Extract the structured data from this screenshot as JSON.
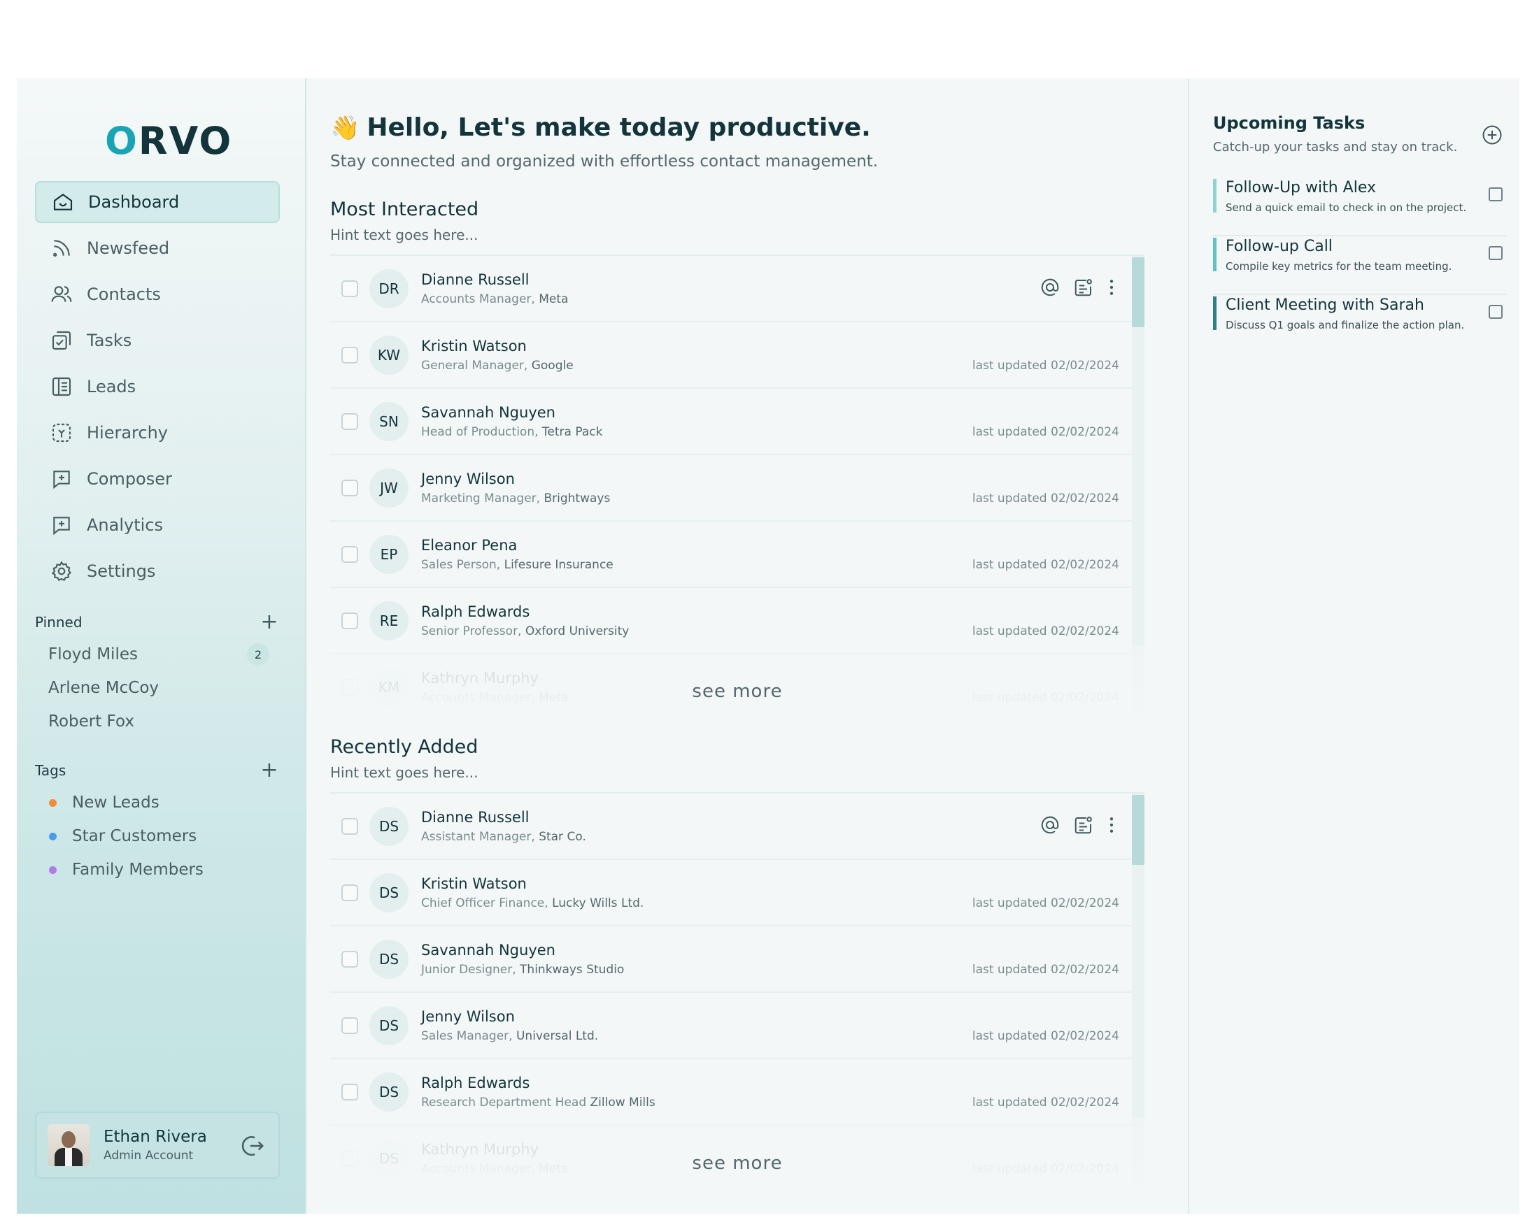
{
  "brand": {
    "logo_first": "O",
    "logo_rest": "RVO",
    "accent": "#18a4b4"
  },
  "sidebar": {
    "nav": [
      {
        "label": "Dashboard",
        "icon": "home-icon",
        "active": true
      },
      {
        "label": "Newsfeed",
        "icon": "rss-icon"
      },
      {
        "label": "Contacts",
        "icon": "users-icon"
      },
      {
        "label": "Tasks",
        "icon": "tasks-icon"
      },
      {
        "label": "Leads",
        "icon": "leads-icon"
      },
      {
        "label": "Hierarchy",
        "icon": "hierarchy-icon"
      },
      {
        "label": "Composer",
        "icon": "composer-icon"
      },
      {
        "label": "Analytics",
        "icon": "analytics-icon"
      },
      {
        "label": "Settings",
        "icon": "gear-icon"
      }
    ],
    "pinned_title": "Pinned",
    "pinned": [
      {
        "name": "Floyd Miles",
        "badge": "2"
      },
      {
        "name": "Arlene McCoy"
      },
      {
        "name": "Robert Fox"
      }
    ],
    "tags_title": "Tags",
    "tags": [
      {
        "label": "New Leads",
        "color": "#f28b3c"
      },
      {
        "label": "Star Customers",
        "color": "#4a9be8"
      },
      {
        "label": "Family Members",
        "color": "#b07be8"
      }
    ],
    "user": {
      "name": "Ethan Rivera",
      "role": "Admin Account"
    }
  },
  "main": {
    "greeting_emoji": "👋",
    "greeting": "Hello, Let's make today productive.",
    "subtitle": "Stay connected and organized with effortless contact management.",
    "most_interacted": {
      "title": "Most Interacted",
      "hint": "Hint text goes here...",
      "see_more": "see more",
      "rows": [
        {
          "initials": "DR",
          "name": "Dianne Russell",
          "role": "Accounts Manager,",
          "company": "Meta",
          "updated": ""
        },
        {
          "initials": "KW",
          "name": "Kristin Watson",
          "role": "General Manager,",
          "company": "Google",
          "updated": "last updated 02/02/2024"
        },
        {
          "initials": "SN",
          "name": "Savannah Nguyen",
          "role": "Head of Production,",
          "company": "Tetra Pack",
          "updated": "last updated 02/02/2024"
        },
        {
          "initials": "JW",
          "name": "Jenny Wilson",
          "role": "Marketing Manager,",
          "company": "Brightways",
          "updated": "last updated 02/02/2024"
        },
        {
          "initials": "EP",
          "name": "Eleanor Pena",
          "role": "Sales Person,",
          "company": "Lifesure Insurance",
          "updated": "last updated 02/02/2024"
        },
        {
          "initials": "RE",
          "name": "Ralph Edwards",
          "role": "Senior Professor,",
          "company": "Oxford University",
          "updated": "last updated 02/02/2024"
        },
        {
          "initials": "KM",
          "name": "Kathryn Murphy",
          "role": "Accounts Manager,",
          "company": "Meta",
          "updated": "last updated 02/02/2024"
        }
      ]
    },
    "recently_added": {
      "title": "Recently Added",
      "hint": "Hint text goes here...",
      "see_more": "see more",
      "rows": [
        {
          "initials": "DS",
          "name": "Dianne Russell",
          "role": "Assistant Manager,",
          "company": "Star Co.",
          "updated": ""
        },
        {
          "initials": "DS",
          "name": "Kristin Watson",
          "role": "Chief Officer Finance,",
          "company": "Lucky Wills Ltd.",
          "updated": "last updated 02/02/2024"
        },
        {
          "initials": "DS",
          "name": "Savannah Nguyen",
          "role": "Junior Designer,",
          "company": "Thinkways Studio",
          "updated": "last updated 02/02/2024"
        },
        {
          "initials": "DS",
          "name": "Jenny Wilson",
          "role": "Sales Manager,",
          "company": "Universal Ltd.",
          "updated": "last updated 02/02/2024"
        },
        {
          "initials": "DS",
          "name": "Ralph Edwards",
          "role": "Research Department Head",
          "company": "Zillow Mills",
          "updated": "last updated 02/02/2024"
        },
        {
          "initials": "DS",
          "name": "Kathryn Murphy",
          "role": "Accounts Manager,",
          "company": "Meta",
          "updated": "last updated 02/02/2024"
        }
      ]
    }
  },
  "upcoming": {
    "title": "Upcoming Tasks",
    "subtitle": "Catch-up your tasks and stay on track.",
    "tasks": [
      {
        "title": "Follow-Up with Alex",
        "desc": "Send a quick email to check in on the project.",
        "bar": "#8fd3cf"
      },
      {
        "title": "Follow-up Call",
        "desc": "Compile key metrics for the team meeting.",
        "bar": "#5fc4bf"
      },
      {
        "title": "Client Meeting with Sarah",
        "desc": "Discuss Q1 goals and finalize the action plan.",
        "bar": "#2f7f86"
      }
    ]
  }
}
